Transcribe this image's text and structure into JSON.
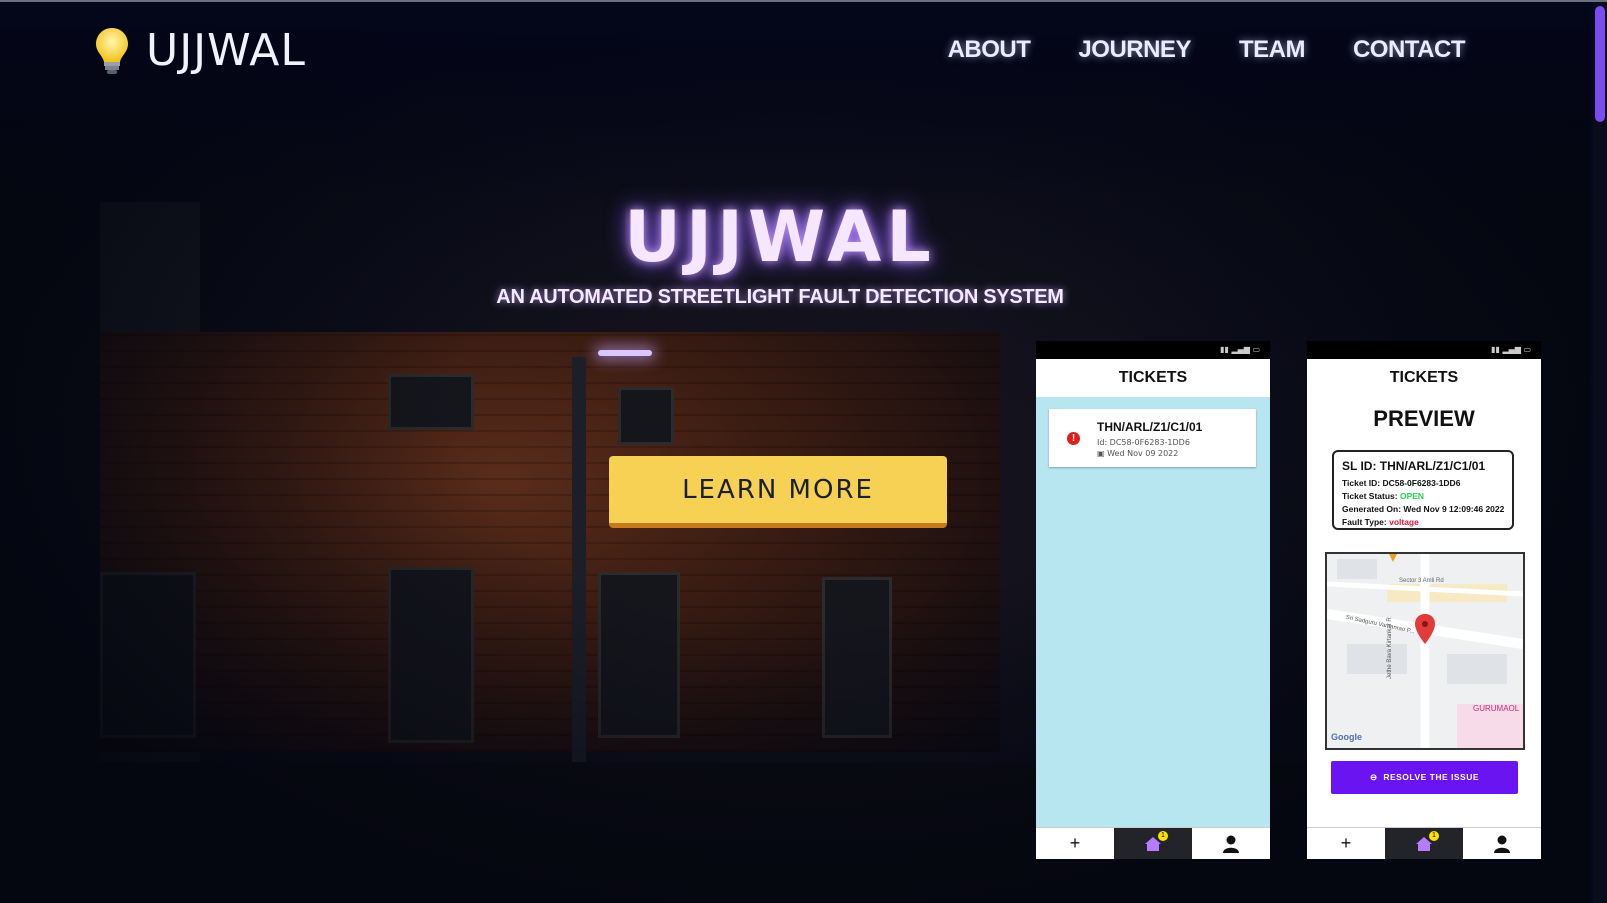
{
  "logo": {
    "text": "UJJWAL"
  },
  "nav": {
    "items": [
      {
        "label": "ABOUT"
      },
      {
        "label": "JOURNEY"
      },
      {
        "label": "TEAM"
      },
      {
        "label": "CONTACT"
      }
    ]
  },
  "hero": {
    "title": "UJJWAL",
    "subtitle": "AN AUTOMATED STREETLIGHT FAULT DETECTION SYSTEM",
    "cta_label": "LEARN MORE"
  },
  "phone1": {
    "title": "TICKETS",
    "ticket": {
      "sl_id": "THN/ARL/Z1/C1/01",
      "id_line": "Id: DC58-0F6283-1DD6",
      "date_line": "Wed Nov 09 2022",
      "alert": "!"
    },
    "tabs": {
      "add": "+",
      "badge": "1"
    }
  },
  "phone2": {
    "title": "TICKETS",
    "heading": "PREVIEW",
    "card": {
      "sl_id": "SL ID: THN/ARL/Z1/C1/01",
      "ticket_id": "Ticket ID:  DC58-0F6283-1DD6",
      "status_label": "Ticket Status:",
      "status_value": "OPEN",
      "generated": "Generated On: Wed Nov  9 12:09:46 2022",
      "fault_label": "Fault Type:",
      "fault_value": "voltage"
    },
    "map": {
      "label_sector": "Sector 3 Amli Rd",
      "label_road": "Sri Sadguru Vamanrao P...",
      "label_road2": "Jethe Bava Kirtankar R",
      "label_place": "GURUMAOL",
      "label_google": "Google"
    },
    "resolve_label": "RESOLVE THE ISSUE",
    "tabs": {
      "add": "+",
      "badge": "1"
    }
  },
  "colors": {
    "accent": "#7a4cf0",
    "cta": "#f7d153",
    "resolve": "#6b14f2"
  }
}
